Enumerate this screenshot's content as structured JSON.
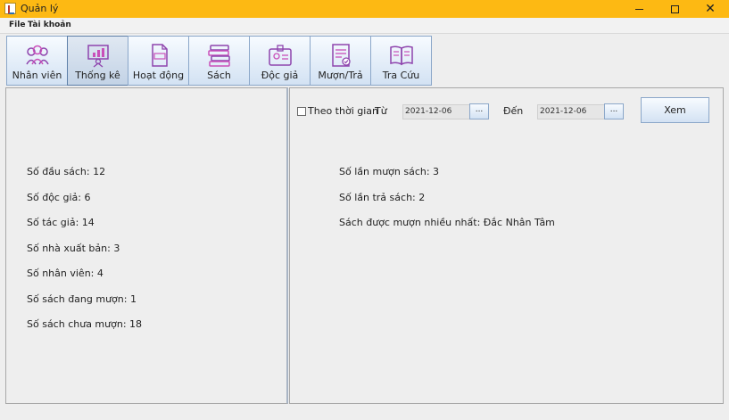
{
  "window": {
    "title": "Quản lý"
  },
  "menu": {
    "file": "File",
    "account": "Tài khoản"
  },
  "toolbar": [
    {
      "label": "Nhân viên",
      "icon": "users-icon"
    },
    {
      "label": "Thống kê",
      "icon": "presentation-chart-icon"
    },
    {
      "label": "Hoạt động",
      "icon": "log-document-icon"
    },
    {
      "label": "Sách",
      "icon": "book-stack-icon"
    },
    {
      "label": "Độc giả",
      "icon": "id-card-icon"
    },
    {
      "label": "Mượn/Trả",
      "icon": "checklist-icon"
    },
    {
      "label": "Tra Cứu",
      "icon": "open-book-icon"
    }
  ],
  "stats": {
    "book_titles": "Số đầu sách: 12",
    "readers": "Số độc giả: 6",
    "authors": "Số tác giả: 14",
    "publishers": "Số nhà xuất bản: 3",
    "staff": "Số nhân viên: 4",
    "borrowed_books": "Số sách đang mượn: 1",
    "not_borrowed_books": "Số sách chưa mượn: 18"
  },
  "filter": {
    "by_time_label": "Theo thời gian",
    "from_label": "Từ",
    "from_date": "2021-12-06",
    "to_label": "Đến",
    "to_date": "2021-12-06",
    "picker_label": "...",
    "view_button": "Xem"
  },
  "activity": {
    "borrow_count": "Số lần mượn sách: 3",
    "return_count": "Số lần trả sách: 2",
    "most_borrowed": "Sách được mượn nhiều nhất: Đắc Nhân Tâm"
  },
  "colors": {
    "titlebar": "#fdb913",
    "button_border": "#8ba7c9",
    "icon_purple": "#8e44ad",
    "icon_pink": "#c94fb9"
  }
}
